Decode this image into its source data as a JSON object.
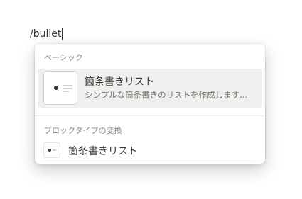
{
  "editor": {
    "text": "/bullet"
  },
  "menu": {
    "basic_header": "ベーシック",
    "bullet_item": {
      "title": "箇条書きリスト",
      "description": "シンプルな箇条書きのリストを作成します..."
    },
    "convert_header": "ブロックタイプの変換",
    "convert_item": {
      "label": "箇条書きリスト"
    }
  },
  "icons": {
    "bullet_thumbnail": "bulleted-list-icon",
    "bullet_mini": "bulleted-list-icon"
  }
}
